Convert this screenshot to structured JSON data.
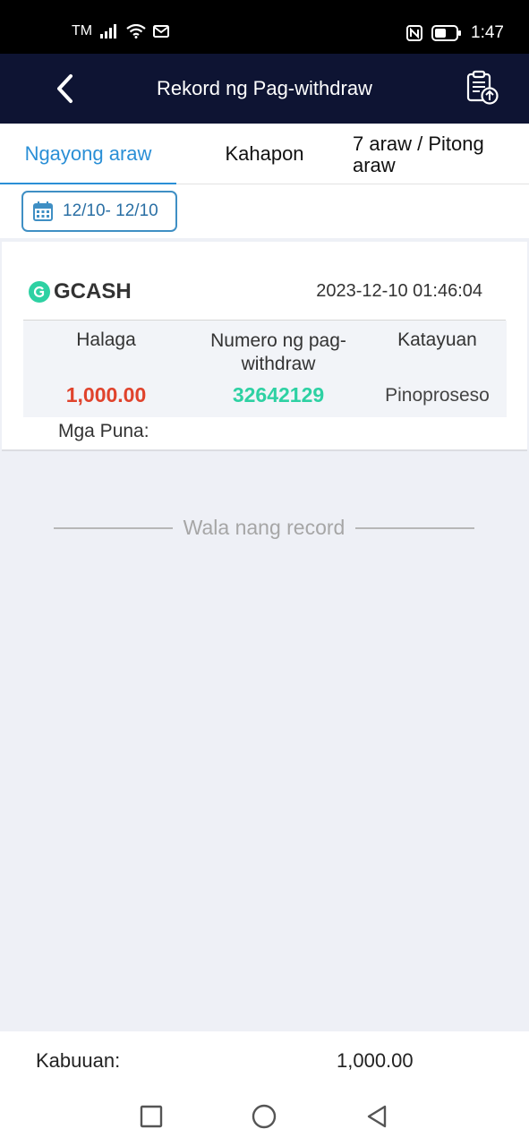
{
  "status_bar": {
    "carrier": "TM",
    "time": "1:47"
  },
  "header": {
    "title": "Rekord ng Pag-withdraw"
  },
  "tabs": [
    {
      "label": "Ngayong araw",
      "active": true
    },
    {
      "label": "Kahapon",
      "active": false
    },
    {
      "label": "7 araw / Pitong araw",
      "active": false
    }
  ],
  "date_filter": {
    "label": "12/10- 12/10"
  },
  "record": {
    "brand": "GCASH",
    "datetime": "2023-12-10 01:46:04",
    "headers": {
      "amount": "Halaga",
      "number": "Numero ng pag-withdraw",
      "status": "Katayuan"
    },
    "amount": "1,000.00",
    "number": "32642129",
    "status": "Pinoproseso",
    "remarks_label": "Mga Puna:"
  },
  "empty_message": "Wala nang record",
  "footer": {
    "total_label": "Kabuuan:",
    "total_value": "1,000.00"
  },
  "colors": {
    "header_bg": "#0e1433",
    "accent": "#2a8fd6",
    "amount": "#e0432c",
    "gcash": "#2ed1a3"
  }
}
